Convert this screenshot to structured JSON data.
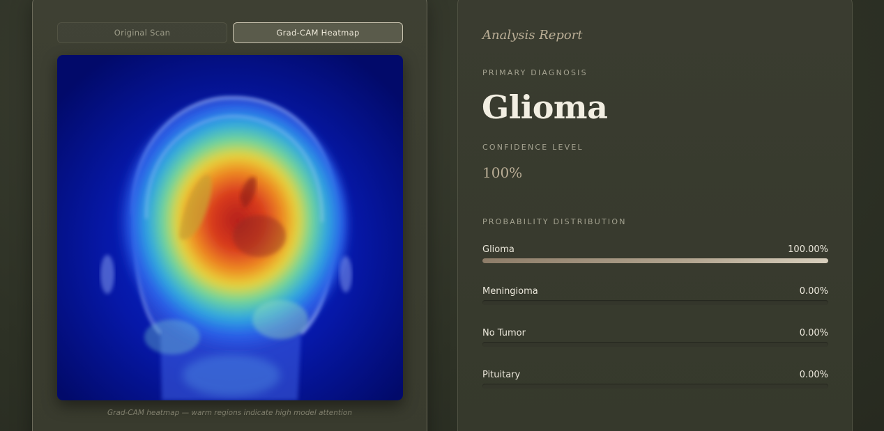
{
  "viewer": {
    "tabs": [
      {
        "label": "Original Scan",
        "active": false
      },
      {
        "label": "Grad-CAM Heatmap",
        "active": true
      }
    ],
    "image_description": "Grad-CAM heatmap overlay on coronal brain MRI",
    "caption": "Grad-CAM heatmap — warm regions indicate high model attention"
  },
  "report": {
    "title": "Analysis Report",
    "primary_label": "PRIMARY DIAGNOSIS",
    "diagnosis": "Glioma",
    "confidence_label": "CONFIDENCE LEVEL",
    "confidence": "100%",
    "distribution_label": "PROBABILITY DISTRIBUTION",
    "probabilities": [
      {
        "name": "Glioma",
        "value": "100.00%",
        "fraction": 1.0
      },
      {
        "name": "Meningioma",
        "value": "0.00%",
        "fraction": 0.0
      },
      {
        "name": "No Tumor",
        "value": "0.00%",
        "fraction": 0.0
      },
      {
        "name": "Pituitary",
        "value": "0.00%",
        "fraction": 0.0
      }
    ]
  },
  "colors": {
    "background": "#2e3226",
    "accent": "#b9ad95",
    "bar_fill": "#b3a590"
  }
}
